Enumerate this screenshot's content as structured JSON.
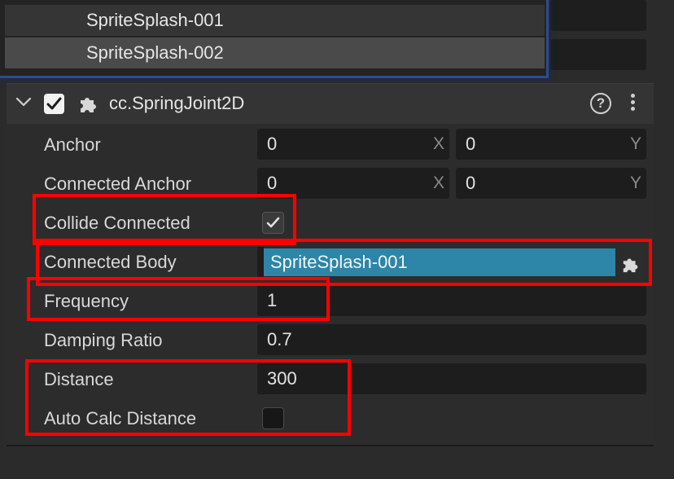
{
  "dropdown": {
    "items": [
      "SpriteSplash-001",
      "SpriteSplash-002"
    ],
    "selected_index": 1
  },
  "component": {
    "title": "cc.SpringJoint2D",
    "enabled": true,
    "help_glyph": "?",
    "icons": [
      "chevron-down-icon",
      "checkbox-icon",
      "puzzle-icon",
      "help-icon",
      "more-vertical-icon"
    ]
  },
  "properties": {
    "anchor": {
      "label": "Anchor",
      "x": "0",
      "y": "0",
      "x_axis": "X",
      "y_axis": "Y"
    },
    "connected_anchor": {
      "label": "Connected Anchor",
      "x": "0",
      "y": "0",
      "x_axis": "X",
      "y_axis": "Y"
    },
    "collide_connected": {
      "label": "Collide Connected",
      "checked": true
    },
    "connected_body": {
      "label": "Connected Body",
      "value": "SpriteSplash-001"
    },
    "frequency": {
      "label": "Frequency",
      "value": "1"
    },
    "damping_ratio": {
      "label": "Damping Ratio",
      "value": "0.7"
    },
    "distance": {
      "label": "Distance",
      "value": "300"
    },
    "auto_calc_distance": {
      "label": "Auto Calc Distance",
      "checked": false
    }
  },
  "colors": {
    "highlight_box": "#ff0000",
    "node_field": "#2d86a8",
    "dropdown_border": "#2e4b8a"
  }
}
